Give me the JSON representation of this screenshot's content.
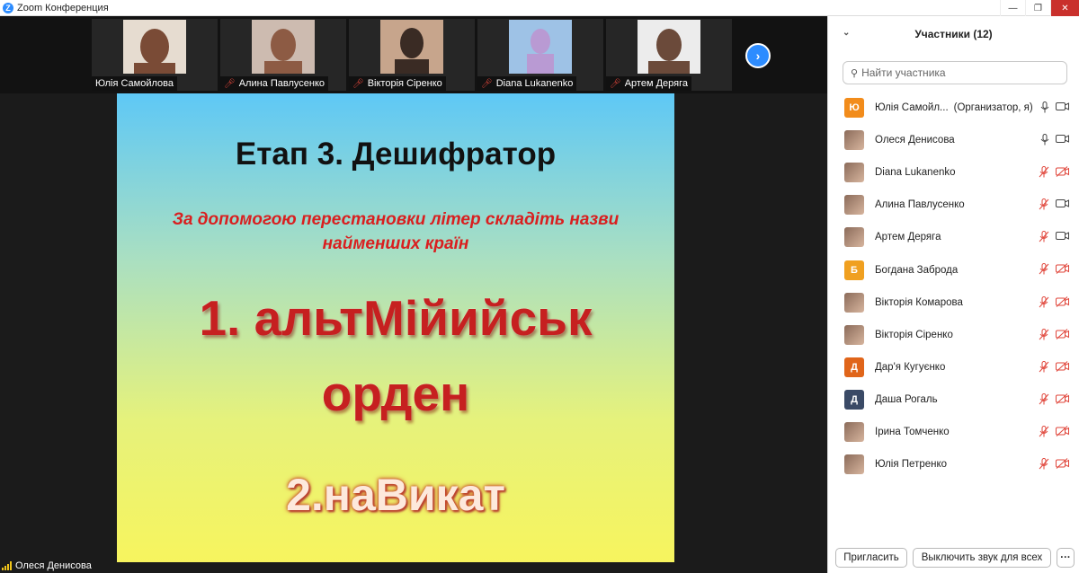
{
  "window": {
    "title": "Zoom Конференция",
    "logo_letter": "Z",
    "controls": [
      "—",
      "❐",
      "✕"
    ]
  },
  "thumbnails": [
    {
      "name": "Юлія Самойлова",
      "muted": false,
      "photo_colors": [
        "#e6dcd0",
        "#7a4b36"
      ]
    },
    {
      "name": "Алина Павлусенко",
      "muted": true,
      "photo_colors": [
        "#cdbbb0",
        "#8d5b44"
      ]
    },
    {
      "name": "Вікторія Сіренко",
      "muted": true,
      "photo_colors": [
        "#c7a58c",
        "#3a2b24"
      ]
    },
    {
      "name": "Diana Lukanenko",
      "muted": true,
      "photo_colors": [
        "#9ec2e6",
        "#b99ad3"
      ]
    },
    {
      "name": "Артем Деряга",
      "muted": true,
      "photo_colors": [
        "#ececec",
        "#6b4a3a"
      ]
    }
  ],
  "next_button": "›",
  "slide": {
    "title": "Етап 3. Дешифратор",
    "instruction": "За допомогою перестановки літер складіть назви найменших країн",
    "puzzle_1_line_1": "1. альтМійийськ",
    "puzzle_1_line_2": "орден",
    "puzzle_2": "2.наВикат"
  },
  "active_speaker": "Олеся Денисова",
  "participants_panel": {
    "header": "Участники (12)",
    "collapse_icon": "⌄",
    "search_placeholder": "Найти участника",
    "participants": [
      {
        "name": "Юлія Самойл...",
        "role": "(Организатор, я)",
        "avatar_letter": "Ю",
        "avatar_color": "#f28c1b",
        "mic_on": true,
        "cam_on": true
      },
      {
        "name": "Олеся Денисова",
        "role": "",
        "avatar_letter": "",
        "avatar_color": "photo",
        "mic_on": true,
        "cam_on": true
      },
      {
        "name": "Diana Lukanenko",
        "role": "",
        "avatar_letter": "",
        "avatar_color": "photo",
        "mic_on": false,
        "cam_on": false
      },
      {
        "name": "Алина Павлусенко",
        "role": "",
        "avatar_letter": "",
        "avatar_color": "photo",
        "mic_on": false,
        "cam_on": true
      },
      {
        "name": "Артем Деряга",
        "role": "",
        "avatar_letter": "",
        "avatar_color": "photo",
        "mic_on": false,
        "cam_on": true
      },
      {
        "name": "Богдана Заброда",
        "role": "",
        "avatar_letter": "Б",
        "avatar_color": "#f0a020",
        "mic_on": false,
        "cam_on": false
      },
      {
        "name": "Вікторія Комарова",
        "role": "",
        "avatar_letter": "",
        "avatar_color": "photo",
        "mic_on": false,
        "cam_on": false
      },
      {
        "name": "Вікторія Сіренко",
        "role": "",
        "avatar_letter": "",
        "avatar_color": "photo",
        "mic_on": false,
        "cam_on": false
      },
      {
        "name": "Дар'я Кугуєнко",
        "role": "",
        "avatar_letter": "Д",
        "avatar_color": "#e0651a",
        "mic_on": false,
        "cam_on": false
      },
      {
        "name": "Даша Рогаль",
        "role": "",
        "avatar_letter": "Д",
        "avatar_color": "#3a4a66",
        "mic_on": false,
        "cam_on": false
      },
      {
        "name": "Ірина Томченко",
        "role": "",
        "avatar_letter": "",
        "avatar_color": "photo",
        "mic_on": false,
        "cam_on": false
      },
      {
        "name": "Юлія Петренко",
        "role": "",
        "avatar_letter": "",
        "avatar_color": "photo",
        "mic_on": false,
        "cam_on": false
      }
    ],
    "invite_label": "Пригласить",
    "mute_all_label": "Выключить звук для всех",
    "more_label": "···"
  }
}
